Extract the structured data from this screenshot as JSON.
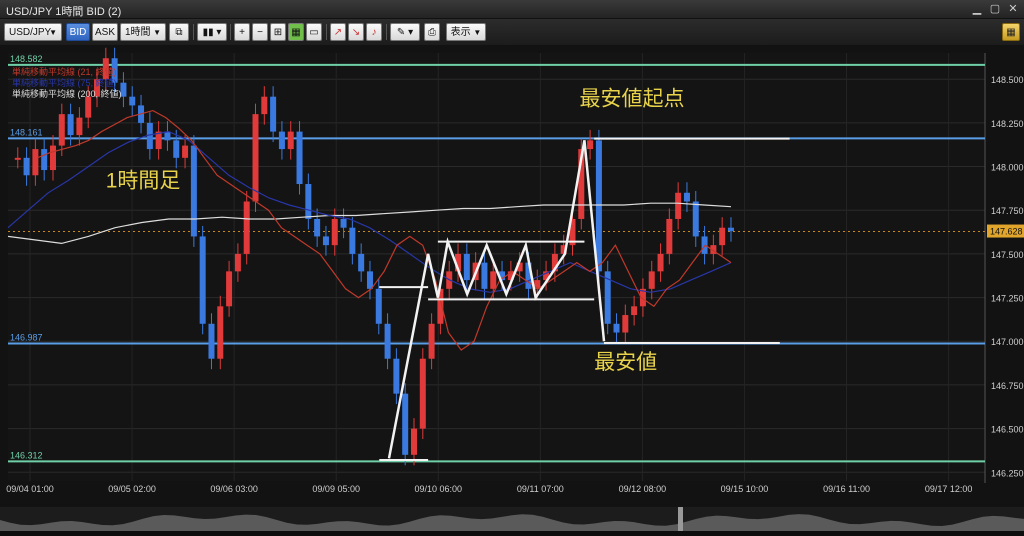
{
  "window": {
    "title": "USD/JPY 1時間 BID (2)"
  },
  "toolbar": {
    "symbol": "USD/JPY",
    "bid_label": "BID",
    "ask_label": "ASK",
    "timeframe": "1時間",
    "view_label": "表示"
  },
  "chart_data": {
    "type": "candlestick",
    "y_ticks": [
      "148.500",
      "148.250",
      "148.000",
      "147.750",
      "147.500",
      "147.250",
      "147.000",
      "146.750",
      "146.500",
      "146.250"
    ],
    "x_ticks": [
      "09/04 01:00",
      "09/05 02:00",
      "09/06 03:00",
      "09/09 05:00",
      "09/10 06:00",
      "09/11 07:00",
      "09/12 08:00",
      "09/15 10:00",
      "09/16 11:00",
      "09/17 12:00"
    ],
    "current_price": "147.628",
    "hlines": [
      {
        "value": 148.582,
        "label": "148.582",
        "color": "#6fd0a8"
      },
      {
        "value": 148.161,
        "label": "148.161",
        "color": "#5a9ee8"
      },
      {
        "value": 146.987,
        "label": "146.987",
        "color": "#5a9ee8"
      },
      {
        "value": 146.312,
        "label": "146.312",
        "color": "#6fd0a8"
      }
    ],
    "legend": [
      {
        "text": "単純移動平均線 (21, 終値)",
        "color": "#c0392b"
      },
      {
        "text": "単純移動平均線 (75, 終値)",
        "color": "#2836a8"
      },
      {
        "text": "単純移動平均線 (200, 終値)",
        "color": "#dddddd"
      }
    ],
    "annotations": {
      "timeframe": "1時間足",
      "start": "最安値起点",
      "low": "最安値"
    },
    "candles": [
      148.05,
      147.95,
      148.1,
      147.98,
      148.12,
      148.3,
      148.18,
      148.28,
      148.4,
      148.5,
      148.62,
      148.48,
      148.4,
      148.35,
      148.25,
      148.1,
      148.2,
      148.15,
      148.05,
      148.12,
      147.6,
      147.1,
      146.9,
      147.2,
      147.4,
      147.5,
      147.8,
      148.3,
      148.4,
      148.2,
      148.1,
      148.2,
      147.9,
      147.7,
      147.6,
      147.55,
      147.7,
      147.65,
      147.5,
      147.4,
      147.3,
      147.1,
      146.9,
      146.7,
      146.35,
      146.5,
      146.9,
      147.1,
      147.3,
      147.4,
      147.5,
      147.35,
      147.45,
      147.3,
      147.4,
      147.35,
      147.4,
      147.45,
      147.3,
      147.35,
      147.4,
      147.5,
      147.55,
      147.7,
      148.1,
      148.15,
      147.4,
      147.1,
      147.05,
      147.15,
      147.2,
      147.3,
      147.4,
      147.5,
      147.7,
      147.85,
      147.8,
      147.6,
      147.5,
      147.55,
      147.65,
      147.63
    ],
    "ma21": [
      148.05,
      148.08,
      148.1,
      148.12,
      148.15,
      148.2,
      148.24,
      148.28,
      148.3,
      148.32,
      148.28,
      148.22,
      148.15,
      148.05,
      147.95,
      147.9,
      147.85,
      147.8,
      147.75,
      147.65,
      147.6,
      147.55,
      147.5,
      147.4,
      147.3,
      147.25,
      147.3,
      147.4,
      147.55,
      147.6,
      147.55,
      147.35,
      147.05,
      146.95,
      147.0,
      147.2,
      147.35,
      147.4,
      147.35,
      147.3,
      147.35,
      147.4,
      147.45,
      147.4,
      147.45,
      147.55,
      147.4,
      147.25,
      147.2,
      147.3,
      147.35,
      147.45,
      147.55,
      147.5,
      147.45
    ],
    "ma75": [
      147.65,
      147.75,
      147.85,
      147.92,
      148.0,
      148.08,
      148.14,
      148.18,
      148.2,
      148.15,
      148.05,
      147.95,
      147.88,
      147.82,
      147.78,
      147.75,
      147.72,
      147.7,
      147.65,
      147.58,
      147.5,
      147.42,
      147.35,
      147.3,
      147.28,
      147.3,
      147.35,
      147.4,
      147.45,
      147.4,
      147.35,
      147.3,
      147.28,
      147.3,
      147.35,
      147.4,
      147.45
    ],
    "ma200": [
      147.6,
      147.58,
      147.56,
      147.6,
      147.65,
      147.68,
      147.7,
      147.7,
      147.71,
      147.7,
      147.7,
      147.71,
      147.72,
      147.72,
      147.73,
      147.74,
      147.75,
      147.76,
      147.76,
      147.77,
      147.78,
      147.78,
      147.78,
      147.78,
      147.79,
      147.79,
      147.78,
      147.77
    ]
  }
}
